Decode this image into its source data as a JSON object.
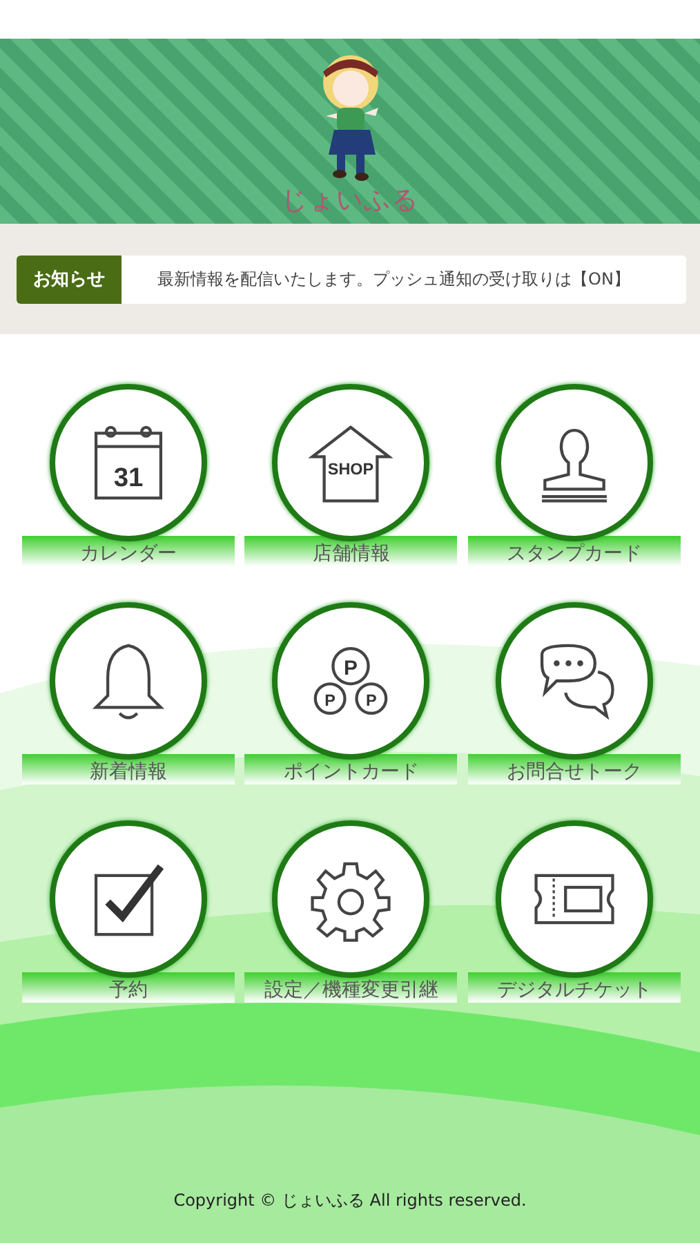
{
  "header": {
    "logo_text": "じょいふる"
  },
  "notice": {
    "label": "お知らせ",
    "message": "最新情報を配信いたします。プッシュ通知の受け取りは【ON】"
  },
  "menu": [
    {
      "label": "カレンダー",
      "kind": "calendar",
      "icon_texts": [
        "31"
      ]
    },
    {
      "label": "店舗情報",
      "kind": "shop",
      "icon_texts": [
        "SHOP"
      ]
    },
    {
      "label": "スタンプカード",
      "kind": "stamp"
    },
    {
      "label": "新着情報",
      "kind": "bell"
    },
    {
      "label": "ポイントカード",
      "kind": "points",
      "icon_texts": [
        "P",
        "P",
        "P"
      ]
    },
    {
      "label": "お問合せトーク",
      "kind": "chat"
    },
    {
      "label": "予約",
      "kind": "check"
    },
    {
      "label": "設定／機種変更引継",
      "kind": "gear"
    },
    {
      "label": "デジタルチケット",
      "kind": "ticket"
    }
  ],
  "footer": "Copyright © じょいふる All rights reserved."
}
